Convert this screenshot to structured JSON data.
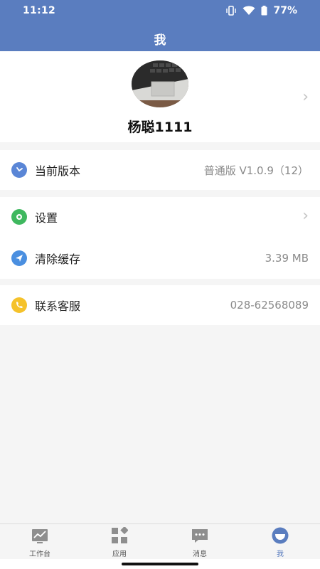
{
  "status": {
    "time": "11:12",
    "battery": "77%"
  },
  "header": {
    "title": "我"
  },
  "profile": {
    "name": "杨聪1111"
  },
  "menu": {
    "version": {
      "label": "当前版本",
      "value": "普通版 V1.0.9（12）",
      "icon": "clock-icon",
      "icon_color": "#5a86d6"
    },
    "settings": {
      "label": "设置",
      "icon": "gear-icon",
      "icon_color": "#3fb85f"
    },
    "clear_cache": {
      "label": "清除缓存",
      "value": "3.39 MB",
      "icon": "paper-plane-icon",
      "icon_color": "#4a8fe0"
    },
    "contact": {
      "label": "联系客服",
      "value": "028-62568089",
      "icon": "phone-icon",
      "icon_color": "#f5c22b"
    }
  },
  "nav": {
    "items": [
      {
        "label": "工作台",
        "icon": "workbench-chart-icon"
      },
      {
        "label": "应用",
        "icon": "apps-grid-icon"
      },
      {
        "label": "消息",
        "icon": "message-icon"
      },
      {
        "label": "我",
        "icon": "profile-face-icon",
        "active": true
      }
    ]
  },
  "colors": {
    "primary": "#5a7dbf",
    "background": "#f5f5f5"
  }
}
